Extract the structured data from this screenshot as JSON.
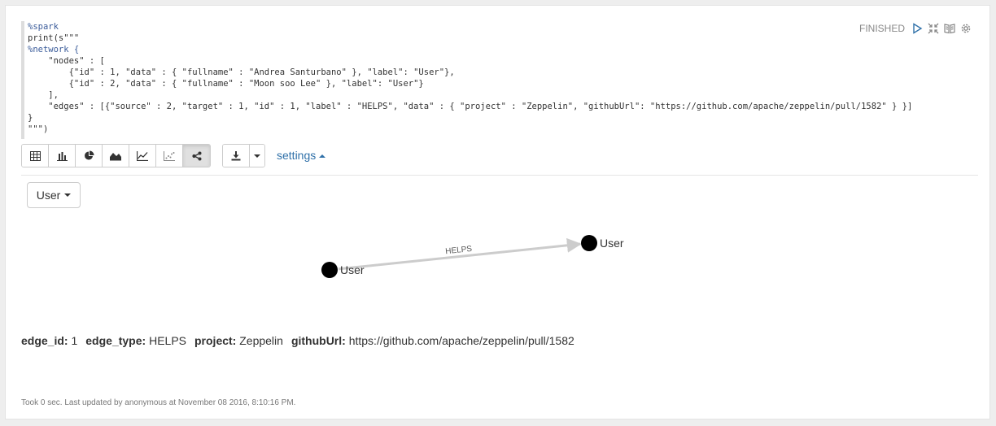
{
  "editor": {
    "lines": [
      "%spark",
      "print(s\"\"\"",
      "%network {",
      "    \"nodes\" : [",
      "        {\"id\" : 1, \"data\" : { \"fullname\" : \"Andrea Santurbano\" }, \"label\": \"User\"},",
      "        {\"id\" : 2, \"data\" : { \"fullname\" : \"Moon soo Lee\" }, \"label\": \"User\"}",
      "    ],",
      "    \"edges\" : [{\"source\" : 2, \"target\" : 1, \"id\" : 1, \"label\" : \"HELPS\", \"data\" : { \"project\" : \"Zeppelin\", \"githubUrl\": \"https://github.com/apache/zeppelin/pull/1582\" } }]",
      "}",
      "\"\"\")"
    ]
  },
  "controls": {
    "status": "FINISHED",
    "icons": [
      "play-icon",
      "collapse-icon",
      "book-icon",
      "gear-icon"
    ]
  },
  "toolbar": {
    "viz_buttons": [
      "table-icon",
      "bar-chart-icon",
      "pie-chart-icon",
      "area-chart-icon",
      "line-chart-icon",
      "scatter-chart-icon",
      "network-icon"
    ],
    "active_viz": "network-icon",
    "settings_label": "settings"
  },
  "filter": {
    "selected": "User"
  },
  "graph": {
    "nodes": [
      {
        "id": 2,
        "label": "User"
      },
      {
        "id": 1,
        "label": "User"
      }
    ],
    "edges": [
      {
        "source": 2,
        "target": 1,
        "label": "HELPS"
      }
    ],
    "node_color": "#000000",
    "edge_color": "#cccccc"
  },
  "details": {
    "edge_id_key": "edge_id:",
    "edge_id_val": "1",
    "edge_type_key": "edge_type:",
    "edge_type_val": "HELPS",
    "project_key": "project:",
    "project_val": "Zeppelin",
    "github_key": "githubUrl:",
    "github_val": "https://github.com/apache/zeppelin/pull/1582"
  },
  "footer": "Took 0 sec. Last updated by anonymous at November 08 2016, 8:10:16 PM."
}
